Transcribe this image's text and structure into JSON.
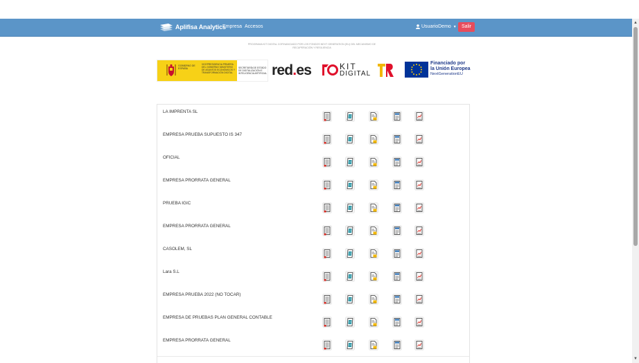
{
  "header": {
    "brand": "Aplifisa Analytics",
    "nav": [
      {
        "label": "Empresa"
      },
      {
        "label": "Accesos"
      }
    ],
    "user_label": "UsuarioDemo",
    "logout_label": "Salir"
  },
  "program_text": "PROGRAMA KIT DIGITAL COFINANCIADO POR LOS FONDOS NEXT GENERATION (EU) DEL MECANISMO DE RECUPERACIÓN Y RESILIENCIA",
  "logos": {
    "gob_line1": "GOBIERNO DE ESPAÑA",
    "gob_line2": "VICEPRESIDENCIA PRIMERA DEL GOBIERNO MINISTERIO DE ASUNTOS ECONÓMICOS Y TRANSFORMACIÓN DIGITAL",
    "gob_line3": "SECRETARÍA DE ESTADO DE DIGITALIZACIÓN E INTELIGENCIA ARTIFICIAL",
    "redes_main": "red",
    "redes_dot": ".",
    "redes_suffix": "es",
    "kit_line1": "KIT",
    "kit_line2": "DIGITAL",
    "eu_line1": "Financiado por",
    "eu_line2": "la Unión Europea",
    "eu_line3": "NextGenerationEU"
  },
  "companies": [
    {
      "name": "LA IMPRENTA SL"
    },
    {
      "name": "EMPRESA PRUEBA SUPUESTO IS 347"
    },
    {
      "name": "OFICIAL"
    },
    {
      "name": "EMPRESA PRORRATA GENERAL"
    },
    {
      "name": "PRUEBA IGIC"
    },
    {
      "name": "EMPRESA PRORRATA GENERAL"
    },
    {
      "name": "CASOLEM, SL"
    },
    {
      "name": "Lara S.L"
    },
    {
      "name": "EMPRESA PRUEBA 2022 (NO TOCAR)"
    },
    {
      "name": "EMPRESA DE PRUEBAS PLAN GENERAL CONTABLE"
    },
    {
      "name": "EMPRESA PRORRATA GENERAL"
    }
  ],
  "row_icons": [
    "ledger-report-icon",
    "edit-document-icon",
    "invoice-icon",
    "fiscal-model-icon",
    "chart-report-icon"
  ],
  "colors": {
    "navbar": "#5b95c8",
    "logout": "#e74c5c",
    "accent_red": "#d9241c",
    "accent_teal": "#1a8fa0",
    "accent_yellow": "#f2b705"
  }
}
